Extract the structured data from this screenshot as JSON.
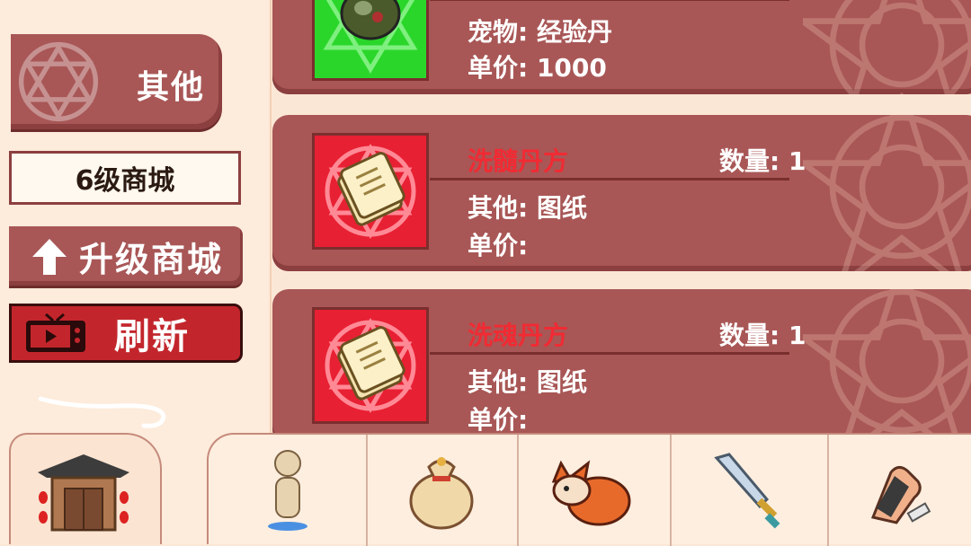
{
  "sidebar": {
    "category_tab": "其他",
    "shop_level": "6级商城",
    "upgrade_label": "升级商城",
    "refresh_label": "刷新"
  },
  "items": [
    {
      "type_text": "宠物: 经验丹",
      "price_text": "单价: 1000",
      "icon": "exp-pill-icon",
      "bg": "#2bd62b"
    },
    {
      "name": "洗髓丹方",
      "qty_text": "数量: 1",
      "type_text": "其他: 图纸",
      "price_text": "单价:",
      "icon": "recipe-scroll-icon",
      "bg": "#e82033"
    },
    {
      "name": "洗魂丹方",
      "qty_text": "数量: 1",
      "type_text": "其他: 图纸",
      "price_text": "单价:",
      "icon": "recipe-scroll-icon",
      "bg": "#e82033"
    }
  ],
  "bottom_nav": [
    {
      "icon": "gate-icon"
    },
    {
      "icon": "character-icon"
    },
    {
      "icon": "bag-icon"
    },
    {
      "icon": "fox-pet-icon"
    },
    {
      "icon": "sword-icon"
    },
    {
      "icon": "glove-icon"
    }
  ],
  "colors": {
    "card_bg": "#a85756",
    "name_red": "#f12a33",
    "refresh_red": "#c2262c",
    "background": "#fbe7d6"
  }
}
